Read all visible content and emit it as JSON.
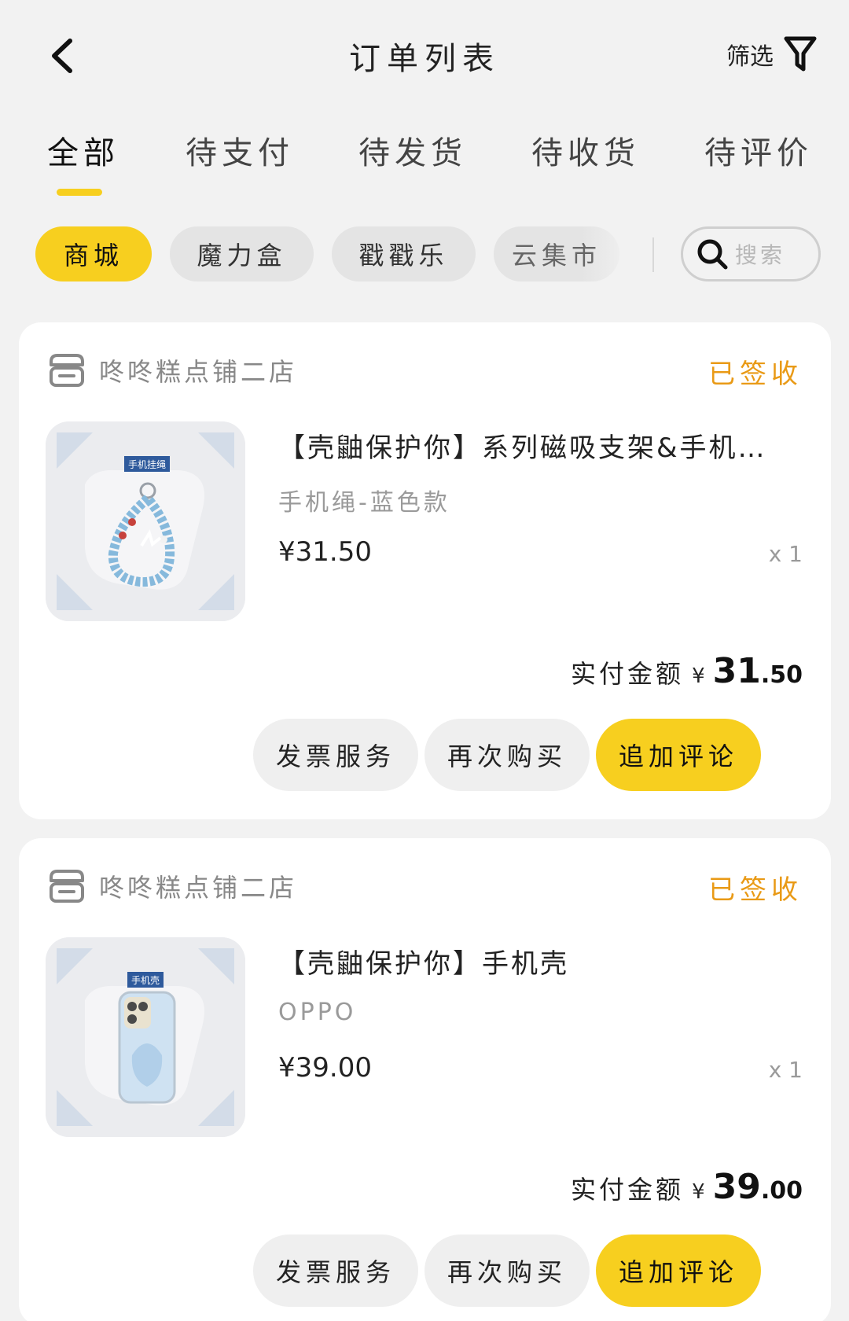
{
  "header": {
    "title": "订单列表",
    "filter_label": "筛选"
  },
  "tabs": [
    "全部",
    "待支付",
    "待发货",
    "待收货",
    "待评价"
  ],
  "chips": [
    "商城",
    "魔力盒",
    "戳戳乐",
    "云集市"
  ],
  "search": {
    "placeholder": "搜索"
  },
  "orders": [
    {
      "shop": "咚咚糕点铺二店",
      "status": "已签收",
      "product_name": "【壳鼬保护你】系列磁吸支架&手机…",
      "variant": "手机绳-蓝色款",
      "price": "¥31.50",
      "quantity": "x 1",
      "thumb_tag": "手机挂绳",
      "total_label": "实付金额",
      "total_currency": "¥",
      "total_int": "31",
      "total_dec": ".50",
      "buttons": [
        "发票服务",
        "再次购买",
        "追加评论"
      ]
    },
    {
      "shop": "咚咚糕点铺二店",
      "status": "已签收",
      "product_name": "【壳鼬保护你】手机壳",
      "variant": "OPPO",
      "price": "¥39.00",
      "quantity": "x 1",
      "thumb_tag": "手机壳",
      "total_label": "实付金额",
      "total_currency": "¥",
      "total_int": "39",
      "total_dec": ".00",
      "buttons": [
        "发票服务",
        "再次购买",
        "追加评论"
      ]
    }
  ],
  "colors": {
    "accent": "#f7cf1f",
    "status": "#e99a16",
    "background": "#f2f2f2"
  },
  "icons": {
    "back": "chevron-left-icon",
    "filter": "funnel-icon",
    "search": "magnifier-icon",
    "shop": "store-icon"
  }
}
